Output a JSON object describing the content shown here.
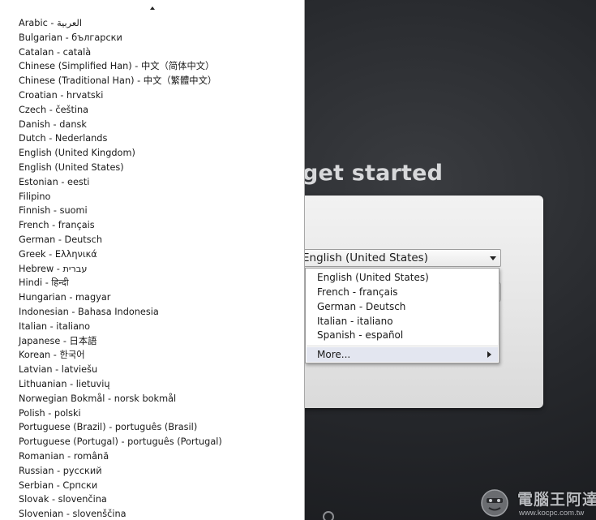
{
  "background": {
    "title": "get started"
  },
  "combo": {
    "selected": "English (United States)",
    "icon": "chevron-down-icon"
  },
  "popup": {
    "items": [
      "English (United States)",
      "French - français",
      "German - Deutsch",
      "Italian - italiano",
      "Spanish - español"
    ],
    "more_label": "More...",
    "more_icon": "chevron-right-icon"
  },
  "language_menu": {
    "scroll_icon": "scroll-up-arrow-icon",
    "items": [
      "Arabic - العربية",
      "Bulgarian - български",
      "Catalan - català",
      "Chinese (Simplified Han) - 中文（简体中文）",
      "Chinese (Traditional Han) - 中文（繁體中文）",
      "Croatian - hrvatski",
      "Czech - čeština",
      "Danish - dansk",
      "Dutch - Nederlands",
      "English (United Kingdom)",
      "English (United States)",
      "Estonian - eesti",
      "Filipino",
      "Finnish - suomi",
      "French - français",
      "German - Deutsch",
      "Greek - Ελληνικά",
      "Hebrew - עברית",
      "Hindi - हिन्दी",
      "Hungarian - magyar",
      "Indonesian - Bahasa Indonesia",
      "Italian - italiano",
      "Japanese - 日本語",
      "Korean - 한국어",
      "Latvian - latviešu",
      "Lithuanian - lietuvių",
      "Norwegian Bokmål - norsk bokmål",
      "Polish - polski",
      "Portuguese (Brazil) - português (Brasil)",
      "Portuguese (Portugal) - português (Portugal)",
      "Romanian - română",
      "Russian - русский",
      "Serbian - Српски",
      "Slovak - slovenčina",
      "Slovenian - slovenščina"
    ]
  },
  "watermark": {
    "name": "電腦王阿達",
    "url": "www.kocpc.com.tw"
  },
  "colors": {
    "background": "#26282c",
    "menu_background": "#ffffff",
    "highlight": "#e3e6f0",
    "text": "#1a1a1a"
  }
}
